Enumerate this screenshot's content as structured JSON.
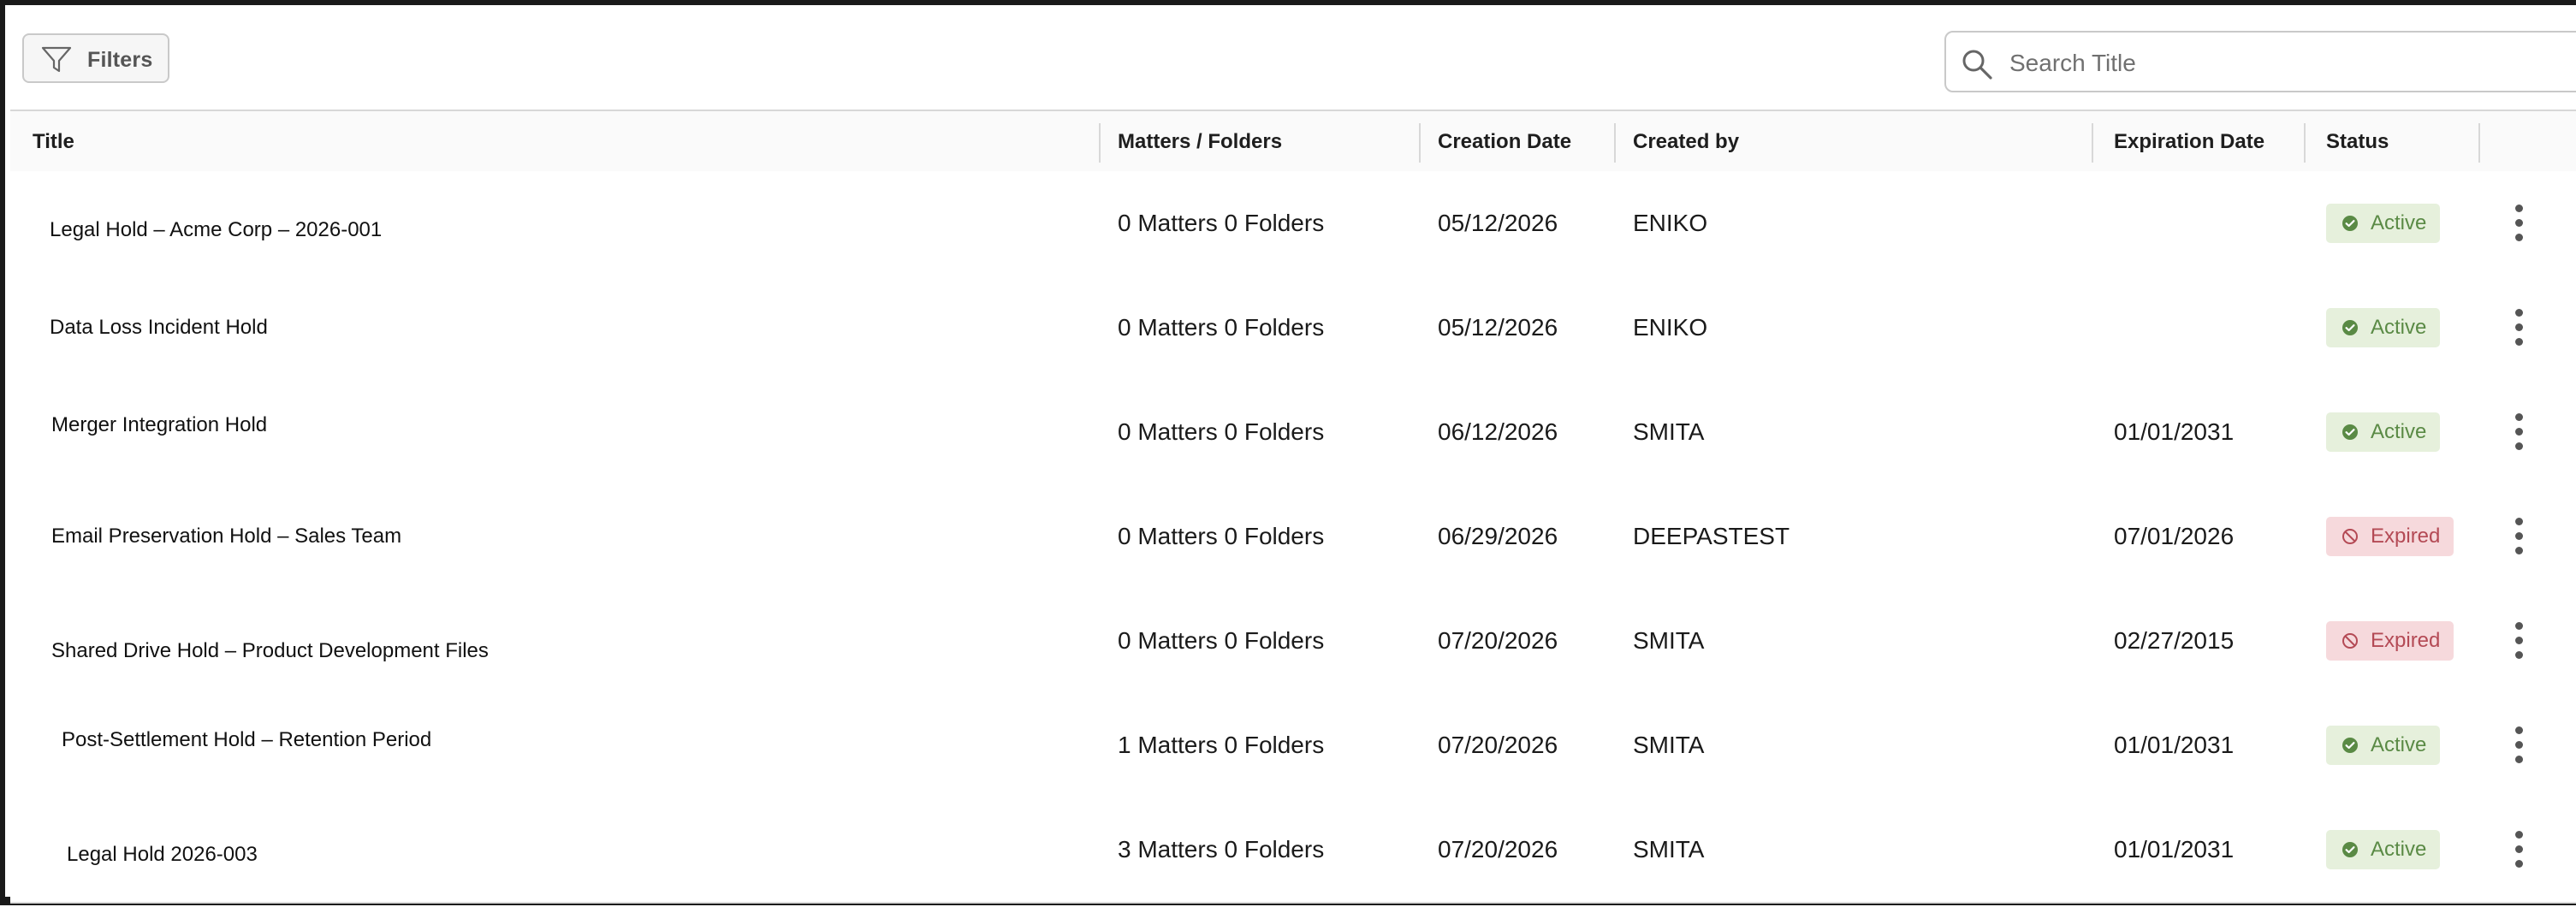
{
  "toolbar": {
    "filters_label": "Filters",
    "filter_icon": "funnel-icon",
    "search_icon": "search-icon",
    "search_placeholder": "Search Title",
    "search_value": ""
  },
  "table": {
    "columns": {
      "title": "Title",
      "matters_folders": "Matters / Folders",
      "creation_date": "Creation Date",
      "created_by": "Created by",
      "expiration_date": "Expiration Date",
      "status": "Status"
    },
    "rows": [
      {
        "title": "Legal Hold – Acme Corp – 2026-001",
        "matters_folders": "0 Matters 0 Folders",
        "creation_date": "05/12/2026",
        "created_by": "ENIKO",
        "expiration_date": "",
        "status": "Active"
      },
      {
        "title": "Data Loss Incident Hold",
        "matters_folders": "0 Matters 0 Folders",
        "creation_date": "05/12/2026",
        "created_by": "ENIKO",
        "expiration_date": "",
        "status": "Active"
      },
      {
        "title": "Merger Integration Hold",
        "matters_folders": "0 Matters 0 Folders",
        "creation_date": "06/12/2026",
        "created_by": "SMITA",
        "expiration_date": "01/01/2031",
        "status": "Active"
      },
      {
        "title": "Email Preservation Hold – Sales Team",
        "matters_folders": "0 Matters 0 Folders",
        "creation_date": "06/29/2026",
        "created_by": "DEEPASTEST",
        "expiration_date": "07/01/2026",
        "status": "Expired"
      },
      {
        "title": "Shared Drive Hold – Product Development Files",
        "matters_folders": "0 Matters 0 Folders",
        "creation_date": "07/20/2026",
        "created_by": "SMITA",
        "expiration_date": "02/27/2015",
        "status": "Expired"
      },
      {
        "title": "Post-Settlement Hold – Retention Period",
        "matters_folders": "1 Matters 0 Folders",
        "creation_date": "07/20/2026",
        "created_by": "SMITA",
        "expiration_date": "01/01/2031",
        "status": "Active"
      },
      {
        "title": "Legal Hold 2026-003",
        "matters_folders": "3 Matters 0 Folders",
        "creation_date": "07/20/2026",
        "created_by": "SMITA",
        "expiration_date": "01/01/2031",
        "status": "Active"
      }
    ]
  },
  "icons": {
    "active": "check-circle-icon",
    "expired": "prohibited-icon",
    "row_menu": "more-vertical-icon"
  },
  "colors": {
    "active_bg": "#e6f0dc",
    "active_fg": "#5a8a45",
    "expired_bg": "#f6d9dc",
    "expired_fg": "#b44a55"
  }
}
